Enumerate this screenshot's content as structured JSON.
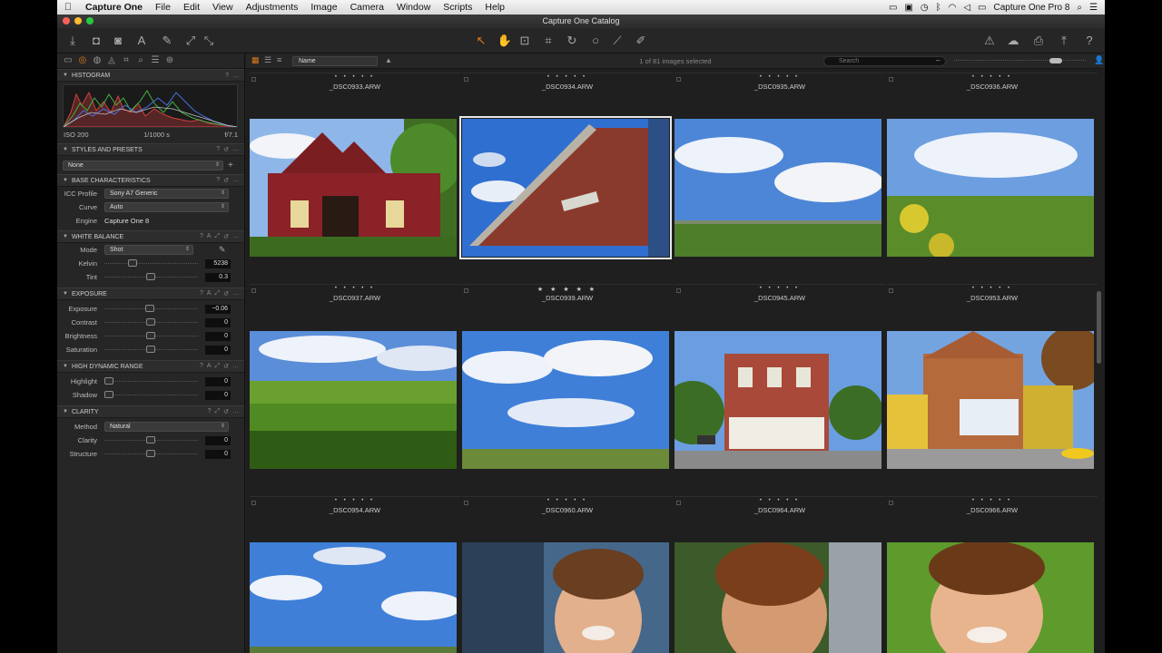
{
  "menubar": {
    "apple": "",
    "app_name": "Capture One",
    "items": [
      "File",
      "Edit",
      "View",
      "Adjustments",
      "Image",
      "Camera",
      "Window",
      "Scripts",
      "Help"
    ],
    "product": "Capture One Pro 8"
  },
  "titlebar": {
    "title": "Capture One Catalog"
  },
  "left": {
    "histogram": {
      "header": "HISTOGRAM",
      "iso": "ISO 200",
      "shutter": "1/1000 s",
      "aperture": "f/7.1"
    },
    "styles": {
      "header": "STYLES AND PRESETS",
      "value": "None"
    },
    "base": {
      "header": "BASE CHARACTERISTICS",
      "icc_label": "ICC Profile",
      "icc_value": "Sony A7 Generic",
      "curve_label": "Curve",
      "curve_value": "Auto",
      "engine_label": "Engine",
      "engine_value": "Capture One 8"
    },
    "wb": {
      "header": "WHITE BALANCE",
      "mode_label": "Mode",
      "mode_value": "Shot",
      "kelvin_label": "Kelvin",
      "kelvin_value": "5238",
      "tint_label": "Tint",
      "tint_value": "0.3"
    },
    "exposure": {
      "header": "EXPOSURE",
      "exposure_label": "Exposure",
      "exposure_value": "−0.06",
      "contrast_label": "Contrast",
      "contrast_value": "0",
      "brightness_label": "Brightness",
      "brightness_value": "0",
      "saturation_label": "Saturation",
      "saturation_value": "0"
    },
    "hdr": {
      "header": "HIGH DYNAMIC RANGE",
      "highlight_label": "Highlight",
      "highlight_value": "0",
      "shadow_label": "Shadow",
      "shadow_value": "0"
    },
    "clarity": {
      "header": "CLARITY",
      "method_label": "Method",
      "method_value": "Natural",
      "clarity_label": "Clarity",
      "clarity_value": "0",
      "structure_label": "Structure",
      "structure_value": "0"
    }
  },
  "browser": {
    "sort": "Name",
    "count": "1 of 81 images selected",
    "search_placeholder": "Search",
    "rows": [
      [
        {
          "name": "_DSC0933.ARW",
          "stars": "• • • • •"
        },
        {
          "name": "_DSC0934.ARW",
          "stars": "• • • • •"
        },
        {
          "name": "_DSC0935.ARW",
          "stars": "• • • • •"
        },
        {
          "name": "_DSC0936.ARW",
          "stars": "• • • • •"
        }
      ],
      [
        {
          "name": "_DSC0937.ARW",
          "stars": "• • • • •"
        },
        {
          "name": "_DSC0939.ARW",
          "stars": "★ ★ ★ ★ ★"
        },
        {
          "name": "_DSC0945.ARW",
          "stars": "• • • • •"
        },
        {
          "name": "_DSC0953.ARW",
          "stars": "• • • • •"
        }
      ],
      [
        {
          "name": "_DSC0954.ARW",
          "stars": "• • • • •"
        },
        {
          "name": "_DSC0960.ARW",
          "stars": "• • • • •"
        },
        {
          "name": "_DSC0964.ARW",
          "stars": "• • • • •"
        },
        {
          "name": "_DSC0966.ARW",
          "stars": "• • • • •"
        }
      ]
    ]
  },
  "colors": {
    "accent": "#e07b1a",
    "panel": "#262626",
    "background": "#1f1f1f"
  }
}
